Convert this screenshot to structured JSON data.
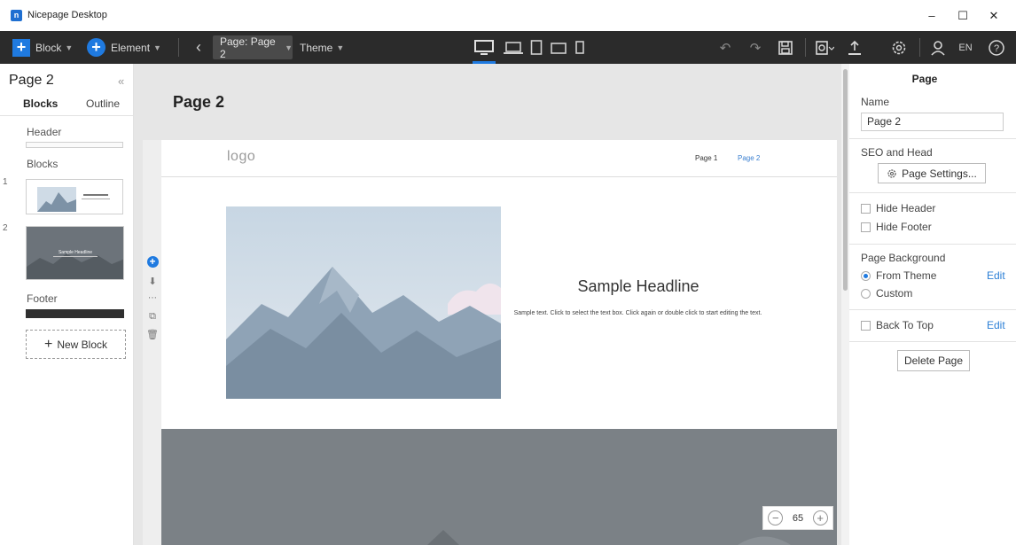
{
  "window": {
    "title": "Nicepage Desktop",
    "logo_letter": "n"
  },
  "toolbar": {
    "block_label": "Block",
    "element_label": "Element",
    "page_chip": "Page: Page 2",
    "theme_label": "Theme",
    "language": "EN",
    "accent_color": "#1f7ae0"
  },
  "left_panel": {
    "title": "Page 2",
    "tabs": [
      "Blocks",
      "Outline"
    ],
    "header_label": "Header",
    "blocks_label": "Blocks",
    "block_numbers": [
      "1",
      "2"
    ],
    "thumb2_text": "Sample Headline",
    "footer_label": "Footer",
    "new_block_label": "New Block"
  },
  "canvas": {
    "page_title": "Page 2",
    "site": {
      "logo": "logo",
      "nav": [
        "Page 1",
        "Page 2"
      ],
      "headline": "Sample Headline",
      "text": "Sample text. Click to select the text box. Click again or double click to start editing the text."
    },
    "zoom": "65"
  },
  "right_panel": {
    "title": "Page",
    "name_label": "Name",
    "name_value": "Page 2",
    "seo_label": "SEO and Head",
    "page_settings_button": "Page Settings...",
    "hide_header": "Hide Header",
    "hide_footer": "Hide Footer",
    "background_label": "Page Background",
    "from_theme": "From Theme",
    "custom": "Custom",
    "edit_label": "Edit",
    "back_to_top": "Back To Top",
    "delete_button": "Delete Page"
  }
}
